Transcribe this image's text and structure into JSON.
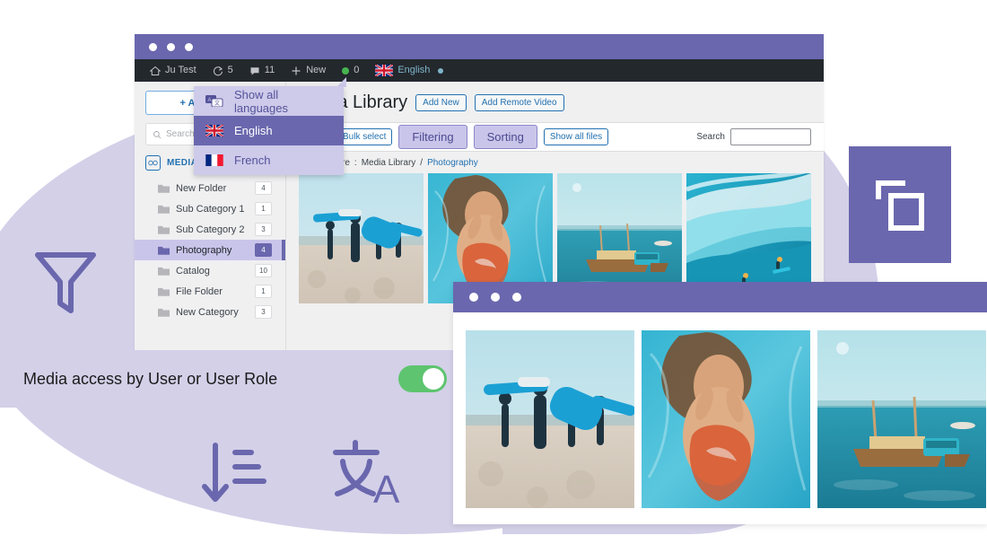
{
  "background": {
    "ellipse_color": "#d3d0e8",
    "accent_purple": "#6a67ae",
    "accent_light": "#c9c5ea"
  },
  "deco_icons": [
    {
      "name": "filter-funnel-icon",
      "label": "Filter"
    },
    {
      "name": "sort-descending-icon",
      "label": "Sorting"
    },
    {
      "name": "translate-icon",
      "label": "Translate"
    },
    {
      "name": "duplicate-copy-icon",
      "label": "Copy"
    }
  ],
  "admin_bar": {
    "site_name": "Ju Test",
    "updates_count": "5",
    "comments_count": "11",
    "new_label": "New",
    "notice_count": "0",
    "language": "English"
  },
  "sidebar": {
    "add_folder_label": "+ Add Folder",
    "search_placeholder": "Search",
    "section_label": "MEDIA LIBRARY",
    "folders": [
      {
        "name": "New Folder",
        "count": "4",
        "active": false
      },
      {
        "name": "Sub Category 1",
        "count": "1",
        "active": false
      },
      {
        "name": "Sub Category 2",
        "count": "3",
        "active": false
      },
      {
        "name": "Photography",
        "count": "4",
        "active": true
      },
      {
        "name": "Catalog",
        "count": "10",
        "active": false
      },
      {
        "name": "File Folder",
        "count": "1",
        "active": false
      },
      {
        "name": "New Category",
        "count": "3",
        "active": false
      }
    ]
  },
  "page": {
    "title": "Media Library",
    "add_new_label": "Add New",
    "add_remote_video_label": "Add Remote Video"
  },
  "toolbar": {
    "bulk_select_label": "Bulk select",
    "filtering_label": "Filtering",
    "sorting_label": "Sorting",
    "all_files_label": "Show all files",
    "search_label": "Search",
    "search_value": ""
  },
  "breadcrumb": {
    "prefix": "You are here",
    "separator": ":",
    "root": "Media Library",
    "slash": "/",
    "current": "Photography"
  },
  "language_menu": {
    "show_all_label": "Show all languages",
    "items": [
      {
        "label": "English",
        "flag": "uk",
        "selected": true
      },
      {
        "label": "French",
        "flag": "france",
        "selected": false
      }
    ]
  },
  "banner": {
    "text": "Media access by User or User Role",
    "toggle_state": "on",
    "toggle_color": "#5ec46f"
  },
  "back_window_thumbs": [
    {
      "alt": "Surfers carrying boards on the beach"
    },
    {
      "alt": "Woman underwater in a pool"
    },
    {
      "alt": "Wooden boats on turquoise sea"
    },
    {
      "alt": "Surfers riding a big ocean wave"
    }
  ],
  "front_window_thumbs": [
    {
      "alt": "Surfers carrying boards on the beach"
    },
    {
      "alt": "Woman underwater in a pool"
    },
    {
      "alt": "Wooden boats on turquoise sea"
    }
  ]
}
